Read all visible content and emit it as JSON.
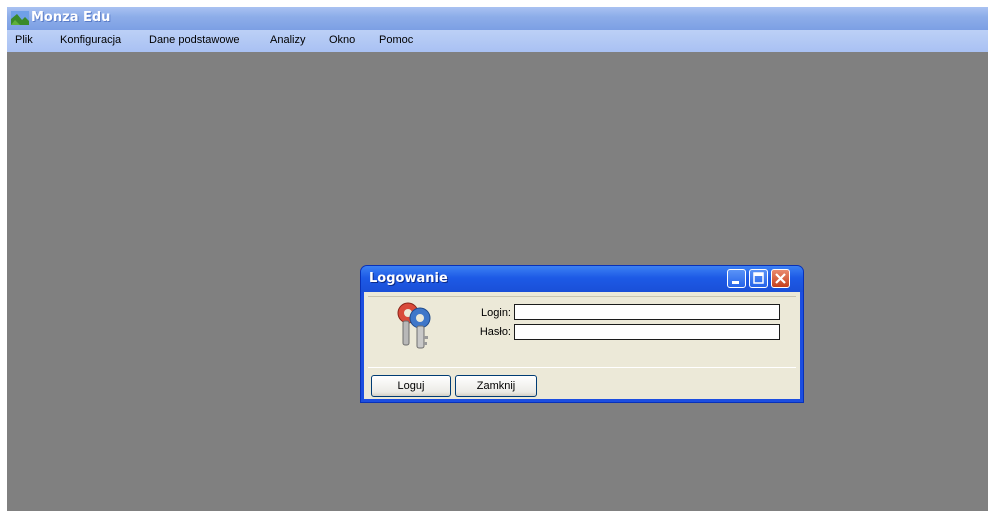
{
  "app": {
    "title": "Monza Edu",
    "icon": "landscape-app-icon"
  },
  "menu": {
    "items": [
      {
        "label": "Plik"
      },
      {
        "label": "Konfiguracja"
      },
      {
        "label": "Dane podstawowe"
      },
      {
        "label": "Analizy"
      },
      {
        "label": "Okno"
      },
      {
        "label": "Pomoc"
      }
    ]
  },
  "dialog": {
    "title": "Logowanie",
    "icon": "keys-icon",
    "login_label": "Login:",
    "login_value": "",
    "password_label": "Hasło:",
    "password_value": "",
    "login_button": "Loguj",
    "close_button": "Zamknij"
  },
  "colors": {
    "workspace": "#808080",
    "titlebar": "#8eaee9",
    "menubar": "#bcd0f6",
    "dialog_titlebar": "#1d5ae6",
    "dialog_body": "#ece9d8"
  }
}
